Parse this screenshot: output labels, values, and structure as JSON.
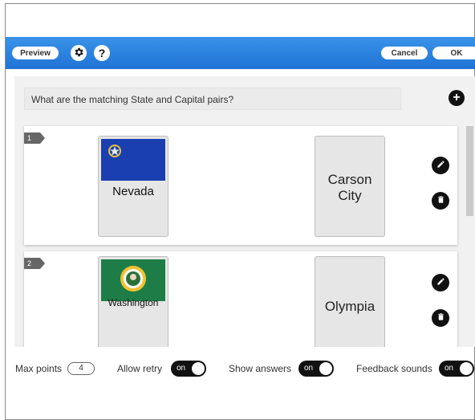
{
  "toolbar": {
    "preview_label": "Preview",
    "help_label": "?",
    "cancel_label": "Cancel",
    "ok_label": "OK"
  },
  "question": {
    "text": "What are the matching State and Capital pairs?"
  },
  "pairs": [
    {
      "number": "1",
      "state": "Nevada",
      "capital_line1": "Carson",
      "capital_line2": "City"
    },
    {
      "number": "2",
      "state": "Washington",
      "capital_line1": "Olympia"
    }
  ],
  "footer": {
    "max_points_label": "Max points",
    "max_points_value": "4",
    "allow_retry_label": "Allow retry",
    "allow_retry_state": "on",
    "show_answers_label": "Show answers",
    "show_answers_state": "on",
    "feedback_sounds_label": "Feedback sounds",
    "feedback_sounds_state": "on"
  },
  "colors": {
    "toolbar_blue": "#1f73d6",
    "nevada_blue": "#1a3fb0",
    "washington_green": "#1e7d46"
  },
  "icons": [
    "gear-icon",
    "help-icon",
    "plus-icon",
    "pencil-icon",
    "trash-icon"
  ]
}
